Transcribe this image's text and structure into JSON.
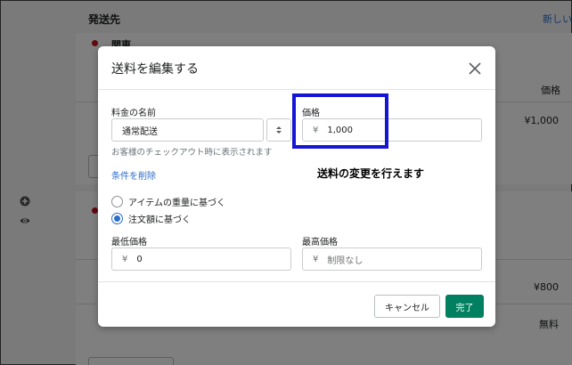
{
  "background": {
    "page_title": "発送先",
    "new_link": "新しい",
    "zone_name": "関東",
    "column_header": "価格",
    "prices": [
      "¥1,000",
      "¥800",
      "無料"
    ]
  },
  "modal": {
    "title": "送料を編集する",
    "rate_name_label": "料金の名前",
    "rate_name_value": "通常配送",
    "price_label": "価格",
    "currency_symbol": "¥",
    "price_value": "1,000",
    "help_text": "お客様のチェックアウト時に表示されます",
    "remove_conditions": "条件を削除",
    "annotation": "送料の変更を行えます",
    "radio_options": [
      {
        "label": "アイテムの重量に基づく",
        "checked": false
      },
      {
        "label": "注文額に基づく",
        "checked": true
      }
    ],
    "min_price_label": "最低価格",
    "min_price_value": "0",
    "max_price_label": "最高価格",
    "max_price_placeholder": "制限なし",
    "cancel_label": "キャンセル",
    "done_label": "完了"
  },
  "colors": {
    "primary": "#008060",
    "link": "#2c6ecb",
    "annotation_border": "#1515d6",
    "status_dot": "#c0151c"
  },
  "icons": [
    "close-icon",
    "select-arrows-icon",
    "plus-circle-icon",
    "eye-icon"
  ]
}
